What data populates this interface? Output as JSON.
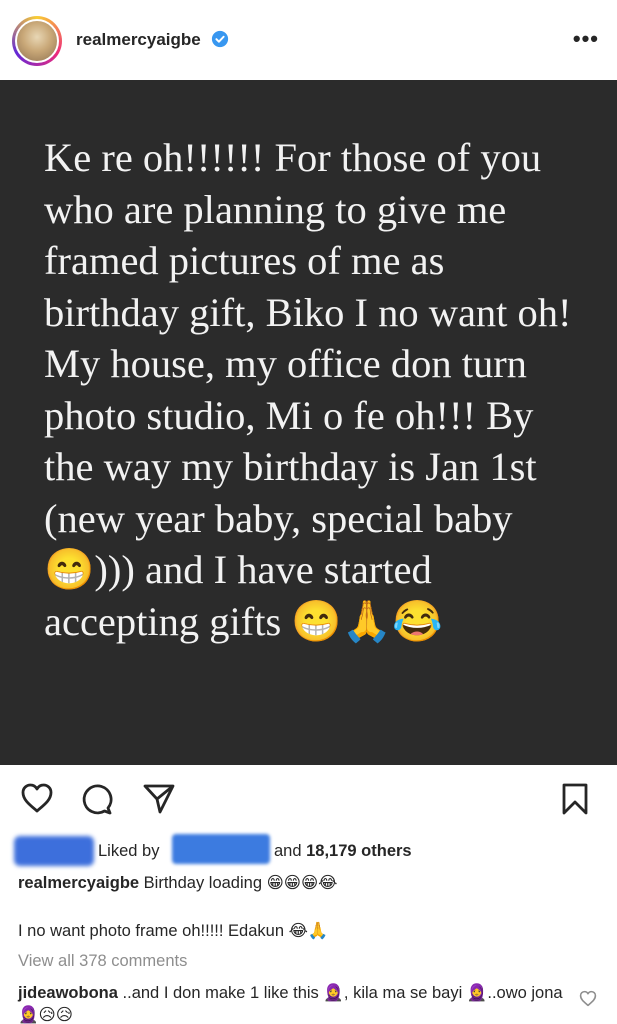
{
  "header": {
    "username": "realmercyaigbe",
    "more_label": "•••"
  },
  "post": {
    "text": "Ke re oh!!!!!! For those of you who are planning to give me framed pictures of me as birthday gift, Biko I no want oh! My house, my office don turn photo studio, Mi o fe oh!!! By the way my birthday is Jan 1st (new year baby, special baby 😁))) and I have started accepting gifts 😁🙏😂"
  },
  "likes": {
    "prefix": "Liked by",
    "and": "and",
    "count": "18,179 others"
  },
  "caption": {
    "user": "realmercyaigbe",
    "text": "Birthday loading 😁😁😁😂",
    "line2": "I no want photo frame oh!!!!! Edakun 😂🙏"
  },
  "comments": {
    "view_all": "View all 378 comments",
    "first_user": "jideawobona",
    "first_text": "..and I don make 1 like this 🧕, kila ma se bayi 🧕..owo jona 🧕😥😥"
  },
  "colors": {
    "post_bg": "#2b2b2b",
    "post_text": "#f2f2f2",
    "verified": "#3897f0",
    "muted": "#8e8e8e"
  },
  "icons": [
    "verified-icon",
    "more-icon",
    "heart-icon",
    "comment-icon",
    "share-icon",
    "bookmark-icon",
    "small-heart-icon"
  ]
}
